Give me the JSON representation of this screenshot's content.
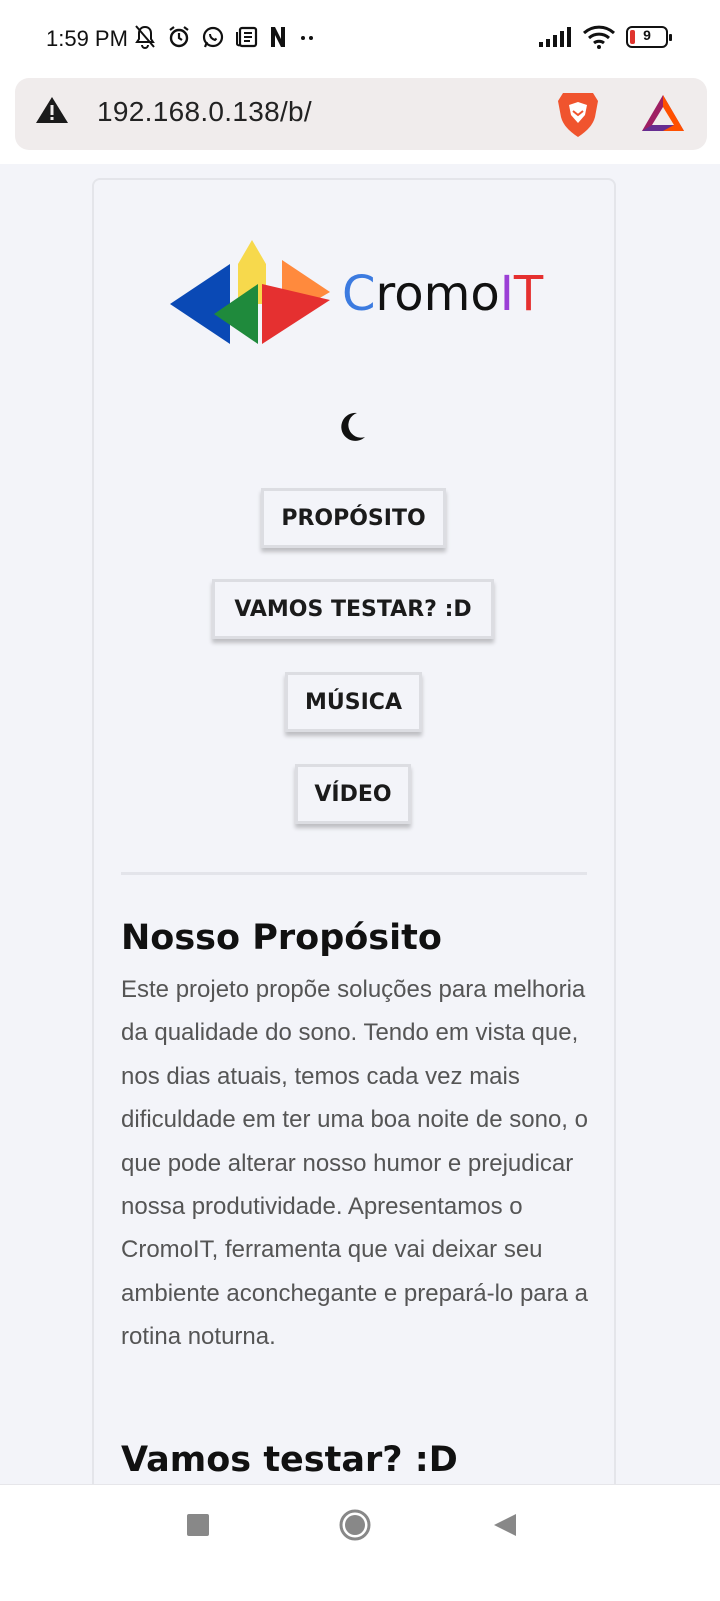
{
  "status_bar": {
    "time": "1:59 PM",
    "battery_level": "9",
    "icons": [
      "mute-icon",
      "alarm-icon",
      "whatsapp-icon",
      "news-icon",
      "netflix-icon",
      "more-dots-icon",
      "signal-icon",
      "wifi-icon",
      "battery-icon"
    ]
  },
  "browser": {
    "url": "192.168.0.138/b/",
    "security_icon": "warning-icon",
    "right_icons": [
      "brave-lion-icon",
      "bat-rewards-icon"
    ]
  },
  "logo": {
    "word_parts": [
      "C",
      "romo",
      "I",
      "T"
    ],
    "colors": {
      "blue": "#3c7be0",
      "dark": "#111111",
      "purple": "#9b3fd6",
      "red": "#e53030",
      "yellow": "#f7d94c",
      "green": "#1f8a3c",
      "orange": "#ff8a3d",
      "royal": "#0a49b5"
    }
  },
  "theme_toggle_icon": "moon-icon",
  "nav": {
    "buttons": [
      "PROPÓSITO",
      "VAMOS TESTAR? :D",
      "MÚSICA",
      "VÍDEO"
    ]
  },
  "sections": {
    "purpose": {
      "title": "Nosso Propósito",
      "text": "Este projeto propõe soluções para melhoria da qualidade do sono. Tendo em vista que, nos dias atuais, temos cada vez mais dificuldade em ter uma boa noite de sono, o que pode alterar nosso humor e prejudicar nossa produtividade. Apresentamos o CromoIT, ferramenta que vai deixar seu ambiente aconchegante e prepará-lo para a rotina noturna."
    },
    "test": {
      "title": "Vamos testar? :D"
    }
  },
  "system_nav": [
    "recents-square-icon",
    "home-circle-icon",
    "back-triangle-icon"
  ]
}
